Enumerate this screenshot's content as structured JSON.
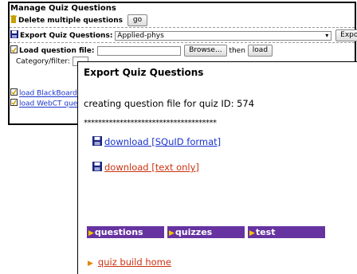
{
  "manage": {
    "title": "Manage Quiz Questions",
    "delete_label": "Delete multiple questions",
    "go_label": "go",
    "export_label": "Export Quiz Questions:",
    "export_select_value": "Applied-phys",
    "export_button": "Export",
    "load_label": "Load question file:",
    "browse_button": "Browse...",
    "then_text": "then",
    "load_button": "load",
    "category_label": "Category/filter:",
    "blackboard_link": "load BlackBoard/ Q",
    "webct_link": "load WebCT quest"
  },
  "popup": {
    "title": "Export Quiz Questions",
    "message": "creating question file for quiz ID: 574",
    "stars": "*************************************",
    "download_squid": "download [SQuID format]",
    "download_text": "download [text only]",
    "nav": {
      "questions": "questions",
      "quizzes": "quizzes",
      "test": "test"
    },
    "home_link": "quiz build home"
  },
  "colors": {
    "nav_purple": "#6633a0",
    "nav_arrow": "#f5c400",
    "link_blue": "#1a33cc",
    "link_red": "#cc3311"
  },
  "icons": [
    "trash-icon",
    "floppy-disk-icon",
    "load-file-icon",
    "chevron-down-icon",
    "triangle-right-icon"
  ]
}
